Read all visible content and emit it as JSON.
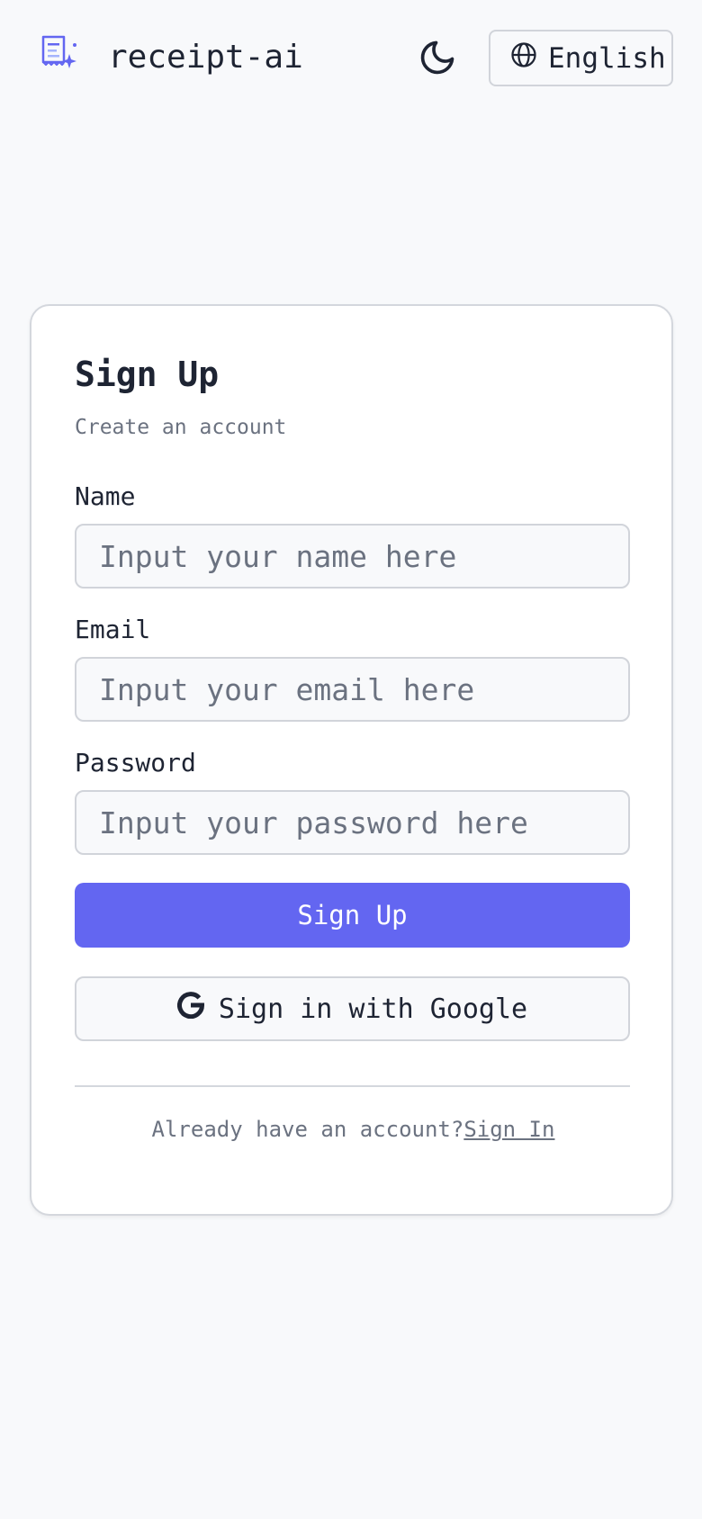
{
  "header": {
    "app_title": "receipt-ai",
    "language_label": "English",
    "icons": {
      "logo": "receipt-sparkle-icon",
      "theme": "moon-icon",
      "language": "globe-icon"
    }
  },
  "form": {
    "title": "Sign Up",
    "subtitle": "Create an account",
    "fields": [
      {
        "label": "Name",
        "value": "",
        "placeholder": "Input your name here"
      },
      {
        "label": "Email",
        "value": "",
        "placeholder": "Input your email here"
      },
      {
        "label": "Password",
        "value": "",
        "placeholder": "Input your password here"
      }
    ],
    "submit_label": "Sign Up",
    "google_label": "Sign in with Google",
    "footer_prompt": "Already have an account?",
    "signin_link": "Sign In"
  },
  "colors": {
    "accent": "#6366f1",
    "background": "#f8f9fb",
    "text": "#1e2433",
    "muted": "#6b7280"
  }
}
